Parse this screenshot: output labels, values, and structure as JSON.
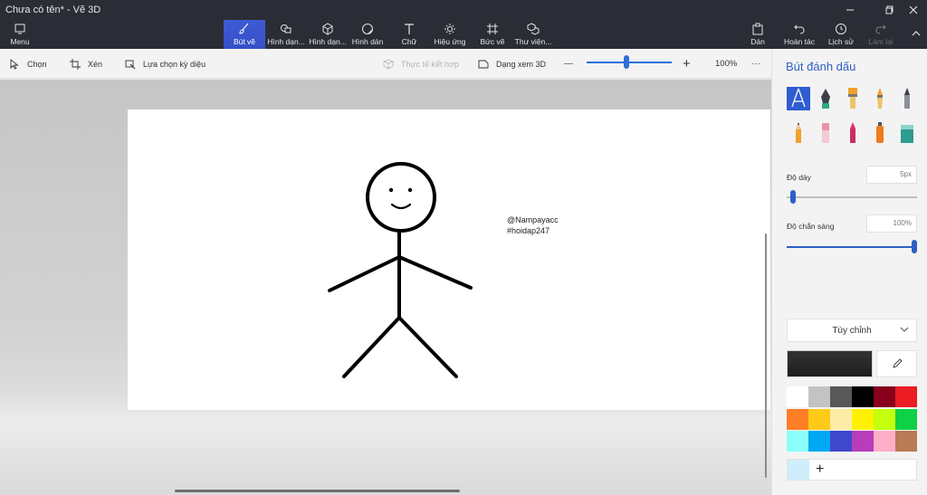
{
  "app": {
    "title": "Chưa có tên* - Vẽ 3D",
    "window_controls": [
      "minimize-icon",
      "maximize-icon",
      "close-icon"
    ]
  },
  "ribbon": {
    "menu_label": "Menu",
    "tools": [
      {
        "label": "Bút vẽ",
        "icon": "brush-icon",
        "active": true
      },
      {
        "label": "Hình dạn...",
        "icon": "2d-shapes-icon"
      },
      {
        "label": "Hình dạn...",
        "icon": "3d-shapes-icon"
      },
      {
        "label": "Hình dán",
        "icon": "sticker-icon"
      },
      {
        "label": "Chữ",
        "icon": "text-icon"
      },
      {
        "label": "Hiệu ứng",
        "icon": "effects-icon"
      },
      {
        "label": "Bức vẽ",
        "icon": "canvas-icon"
      },
      {
        "label": "Thư viện...",
        "icon": "3d-library-icon"
      }
    ],
    "right": [
      {
        "label": "Dán",
        "icon": "paste-icon"
      },
      {
        "label": "Hoàn tác",
        "icon": "undo-icon"
      },
      {
        "label": "Lịch sử",
        "icon": "history-icon"
      },
      {
        "label": "Làm lại",
        "icon": "redo-icon",
        "disabled": true
      }
    ]
  },
  "toolbar": {
    "select": "Chọn",
    "crop": "Xén",
    "magic_select": "Lựa chọn kỳ diệu",
    "mixed_reality": "Thực tế kết hợp",
    "view_3d": "Dạng xem 3D",
    "zoom_out": "—",
    "zoom_in": "+",
    "zoom_level": "100%",
    "zoom_fraction": 0.47,
    "more": "···"
  },
  "canvas": {
    "watermark_line1": "@Nampayacc",
    "watermark_line2": "#hoidap247"
  },
  "panel": {
    "title": "Bút đánh dấu",
    "brushes": [
      {
        "name": "marker",
        "selected": true
      },
      {
        "name": "calligraphy-pen"
      },
      {
        "name": "oil-brush"
      },
      {
        "name": "watercolor"
      },
      {
        "name": "pixel-pen"
      },
      {
        "name": "pencil"
      },
      {
        "name": "eraser"
      },
      {
        "name": "crayon"
      },
      {
        "name": "spraycan"
      },
      {
        "name": "fill"
      }
    ],
    "thickness_label": "Độ dày",
    "thickness_value": "5px",
    "thickness_fraction": 0.05,
    "opacity_label": "Độ chắn sáng",
    "opacity_value": "100%",
    "opacity_fraction": 1.0,
    "color_mode": "Tùy chỉnh",
    "current_color": "#1e1e1e",
    "palette": [
      "#ffffff",
      "#c3c3c3",
      "#585858",
      "#000000",
      "#88001b",
      "#ec1c24",
      "#ff7f27",
      "#ffca18",
      "#fdeca6",
      "#fff200",
      "#c4ff0e",
      "#0ed145",
      "#8cfffb",
      "#00a8f3",
      "#3f48cc",
      "#b83dba",
      "#ffaec8",
      "#b97a56"
    ],
    "custom_color": "#cfeefc",
    "add_color": "+"
  },
  "colors": {
    "chrome": "#2b2d36",
    "accent": "#2f5fc4",
    "active_tool": "#3e5bd4"
  }
}
